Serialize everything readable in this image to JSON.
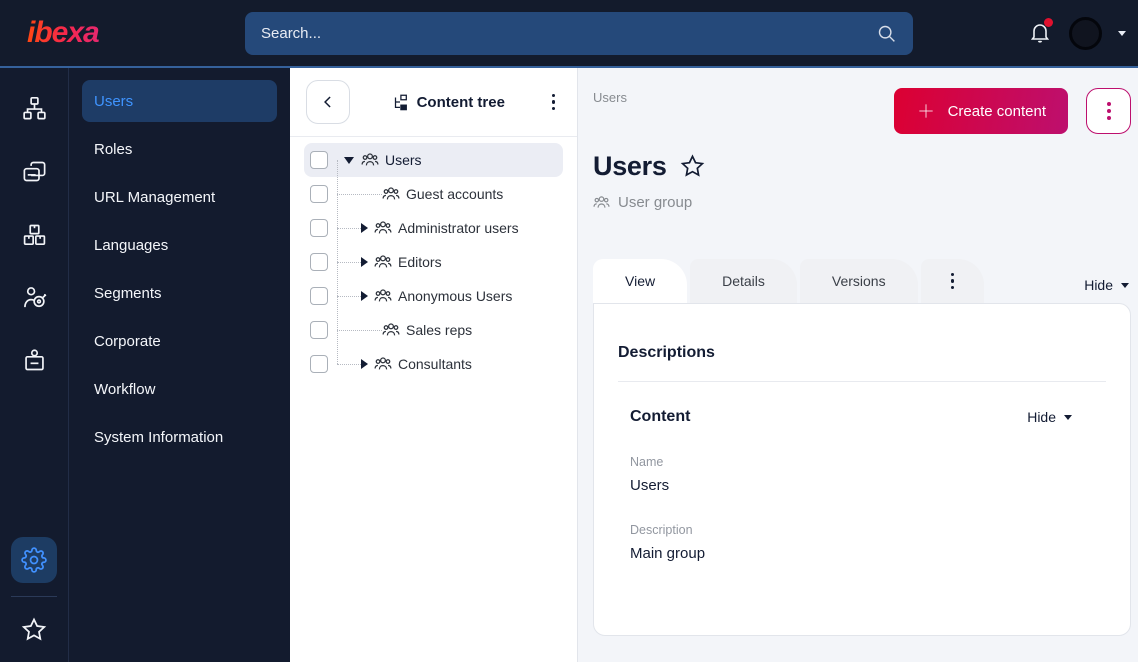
{
  "topbar": {
    "logo": "ibexa",
    "search_placeholder": "Search...",
    "notifications_unread": true
  },
  "rail": {
    "items": [
      {
        "icon": "sitemap-icon"
      },
      {
        "icon": "pages-icon"
      },
      {
        "icon": "products-icon"
      },
      {
        "icon": "personalization-icon"
      },
      {
        "icon": "id-badge-icon"
      }
    ],
    "settings_icon": "gear-icon",
    "bookmarks_icon": "star-icon"
  },
  "sidebar": {
    "items": [
      {
        "label": "Users",
        "active": true
      },
      {
        "label": "Roles"
      },
      {
        "label": "URL Management"
      },
      {
        "label": "Languages"
      },
      {
        "label": "Segments"
      },
      {
        "label": "Corporate"
      },
      {
        "label": "Workflow"
      },
      {
        "label": "System Information"
      }
    ]
  },
  "tree": {
    "title": "Content tree",
    "items": [
      {
        "label": "Users",
        "state": "expanded",
        "selected": true
      },
      {
        "label": "Guest accounts",
        "state": "leaf"
      },
      {
        "label": "Administrator users",
        "state": "collapsed"
      },
      {
        "label": "Editors",
        "state": "collapsed"
      },
      {
        "label": "Anonymous Users",
        "state": "collapsed"
      },
      {
        "label": "Sales reps",
        "state": "leaf"
      },
      {
        "label": "Consultants",
        "state": "collapsed"
      }
    ]
  },
  "main": {
    "breadcrumb": "Users",
    "create_button_label": "Create content",
    "title": "Users",
    "content_type": "User group",
    "tabs": [
      {
        "label": "View",
        "active": true
      },
      {
        "label": "Details"
      },
      {
        "label": "Versions"
      }
    ],
    "hide_label": "Hide",
    "card": {
      "section_title": "Descriptions",
      "group_title": "Content",
      "group_hide_label": "Hide",
      "fields": [
        {
          "label": "Name",
          "value": "Users"
        },
        {
          "label": "Description",
          "value": "Main group"
        }
      ]
    }
  },
  "colors": {
    "topbar_bg": "#131b2c",
    "accent_blue": "#4191ff",
    "brand_red": "#dc0032",
    "brand_magenta": "#bd0f6e",
    "notification_red": "#e0112e",
    "main_bg": "#f3f5f9"
  }
}
